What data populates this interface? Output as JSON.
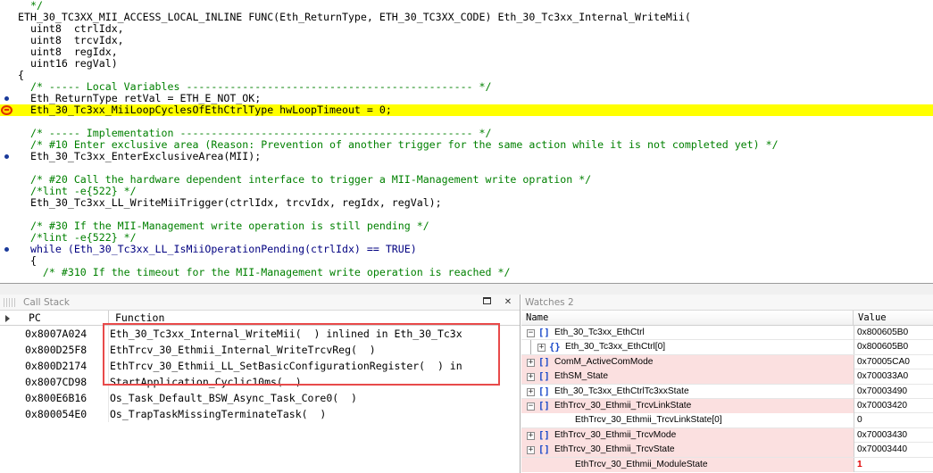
{
  "editor": {
    "lines": [
      {
        "text": "  */",
        "style": "comment",
        "marker": ""
      },
      {
        "text": "ETH_30_TC3XX_MII_ACCESS_LOCAL_INLINE FUNC(Eth_ReturnType, ETH_30_TC3XX_CODE) Eth_30_Tc3xx_Internal_WriteMii(",
        "style": "normal",
        "marker": "",
        "offset": "left"
      },
      {
        "text": "  uint8  ctrlIdx,",
        "style": "normal",
        "marker": "",
        "offset": "left"
      },
      {
        "text": "  uint8  trcvIdx,",
        "style": "normal",
        "marker": "",
        "offset": "left"
      },
      {
        "text": "  uint8  regIdx,",
        "style": "normal",
        "marker": "",
        "offset": "left"
      },
      {
        "text": "  uint16 regVal)",
        "style": "normal",
        "marker": "",
        "offset": "left"
      },
      {
        "text": "{",
        "style": "normal",
        "marker": "",
        "offset": "left"
      },
      {
        "text": "  /* ----- Local Variables ---------------------------------------------- */",
        "style": "comment",
        "marker": "",
        "offset": "left"
      },
      {
        "text": "  Eth_ReturnType retVal = ETH_E_NOT_OK;",
        "style": "normal",
        "marker": "dot",
        "offset": "left"
      },
      {
        "text": "  Eth_30_Tc3xx_MiiLoopCyclesOfEthCtrlType hwLoopTimeout = 0;",
        "style": "current",
        "marker": "arrow",
        "offset": "left"
      },
      {
        "text": "",
        "style": "normal",
        "marker": "",
        "offset": "left"
      },
      {
        "text": "  /* ----- Implementation ----------------------------------------------- */",
        "style": "comment",
        "marker": "",
        "offset": "left"
      },
      {
        "text": "  /* #10 Enter exclusive area (Reason: Prevention of another trigger for the same action while it is not completed yet) */",
        "style": "comment",
        "marker": "",
        "offset": "left"
      },
      {
        "text": "  Eth_30_Tc3xx_EnterExclusiveArea(MII);",
        "style": "normal",
        "marker": "dot",
        "offset": "left"
      },
      {
        "text": "",
        "style": "normal",
        "marker": "",
        "offset": "left"
      },
      {
        "text": "  /* #20 Call the hardware dependent interface to trigger a MII-Management write opration */",
        "style": "comment",
        "marker": "",
        "offset": "left"
      },
      {
        "text": "  /*lint -e{522} */",
        "style": "comment",
        "marker": "",
        "offset": "left"
      },
      {
        "text": "  Eth_30_Tc3xx_LL_WriteMiiTrigger(ctrlIdx, trcvIdx, regIdx, regVal);",
        "style": "normal",
        "marker": "",
        "offset": "left"
      },
      {
        "text": "",
        "style": "normal",
        "marker": "",
        "offset": "left"
      },
      {
        "text": "  /* #30 If the MII-Management write operation is still pending */",
        "style": "comment",
        "marker": "",
        "offset": "left"
      },
      {
        "text": "  /*lint -e{522} */",
        "style": "comment",
        "marker": "",
        "offset": "left"
      },
      {
        "text": "  while (Eth_30_Tc3xx_LL_IsMiiOperationPending(ctrlIdx) == TRUE)",
        "style": "keyword",
        "marker": "dot",
        "offset": "left"
      },
      {
        "text": "  {",
        "style": "normal",
        "marker": "",
        "offset": "left"
      },
      {
        "text": "    /* #310 If the timeout for the MII-Management write operation is reached */",
        "style": "comment",
        "marker": "",
        "offset": "left"
      }
    ]
  },
  "callstack": {
    "title": "Call Stack",
    "buttons": {
      "restore": "",
      "close": "✕"
    },
    "columns": {
      "pc": "PC",
      "function": "Function"
    },
    "rows": [
      {
        "pc": "0x8007A024",
        "function": "Eth_30_Tc3xx_Internal_WriteMii(  ) inlined in Eth_30_Tc3x"
      },
      {
        "pc": "0x800D25F8",
        "function": "EthTrcv_30_Ethmii_Internal_WriteTrcvReg(  )"
      },
      {
        "pc": "0x800D2174",
        "function": "EthTrcv_30_Ethmii_LL_SetBasicConfigurationRegister(  ) in"
      },
      {
        "pc": "0x8007CD98",
        "function": "StartApplication_Cyclic10ms(  )"
      },
      {
        "pc": "0x800E6B16",
        "function": "Os_Task_Default_BSW_Async_Task_Core0(  )"
      },
      {
        "pc": "0x800054E0",
        "function": "Os_TrapTaskMissingTerminateTask(  )"
      }
    ]
  },
  "watch": {
    "title": "Watches 2",
    "columns": {
      "name": "Name",
      "value": "Value"
    },
    "rows": [
      {
        "name": "Eth_30_Tc3xx_EthCtrl",
        "value": "0x800605B0",
        "indent": 0,
        "expander": "−",
        "icon": "[]",
        "highlight": false,
        "red": false
      },
      {
        "name": "Eth_30_Tc3xx_EthCtrl[0]",
        "value": "0x800605B0",
        "indent": 1,
        "expander": "+",
        "icon": "{}",
        "highlight": false,
        "red": false
      },
      {
        "name": "ComM_ActiveComMode",
        "value": "0x70005CA0",
        "indent": 0,
        "expander": "+",
        "icon": "[]",
        "highlight": true,
        "red": false
      },
      {
        "name": "EthSM_State",
        "value": "0x700033A0",
        "indent": 0,
        "expander": "+",
        "icon": "[]",
        "highlight": true,
        "red": false
      },
      {
        "name": "Eth_30_Tc3xx_EthCtrlTc3xxState",
        "value": "0x70003490",
        "indent": 0,
        "expander": "+",
        "icon": "[]",
        "highlight": false,
        "red": false
      },
      {
        "name": "EthTrcv_30_Ethmii_TrcvLinkState",
        "value": "0x70003420",
        "indent": 0,
        "expander": "−",
        "icon": "[]",
        "highlight": true,
        "red": false
      },
      {
        "name": "EthTrcv_30_Ethmii_TrcvLinkState[0]",
        "value": "0",
        "indent": 2,
        "expander": "",
        "icon": "",
        "highlight": false,
        "red": false
      },
      {
        "name": "EthTrcv_30_Ethmii_TrcvMode",
        "value": "0x70003430",
        "indent": 0,
        "expander": "+",
        "icon": "[]",
        "highlight": true,
        "red": false
      },
      {
        "name": "EthTrcv_30_Ethmii_TrcvState",
        "value": "0x70003440",
        "indent": 0,
        "expander": "+",
        "icon": "[]",
        "highlight": true,
        "red": false
      },
      {
        "name": "EthTrcv_30_Ethmii_ModuleState",
        "value": "1",
        "indent": 2,
        "expander": "",
        "icon": "",
        "highlight": true,
        "red": true
      }
    ]
  },
  "colors": {
    "current_line": "#ffff00",
    "comment": "#008000",
    "highlight_box": "#e84a4a",
    "watch_row_pink": "#fbe0e0",
    "changed_value": "#e00000"
  }
}
